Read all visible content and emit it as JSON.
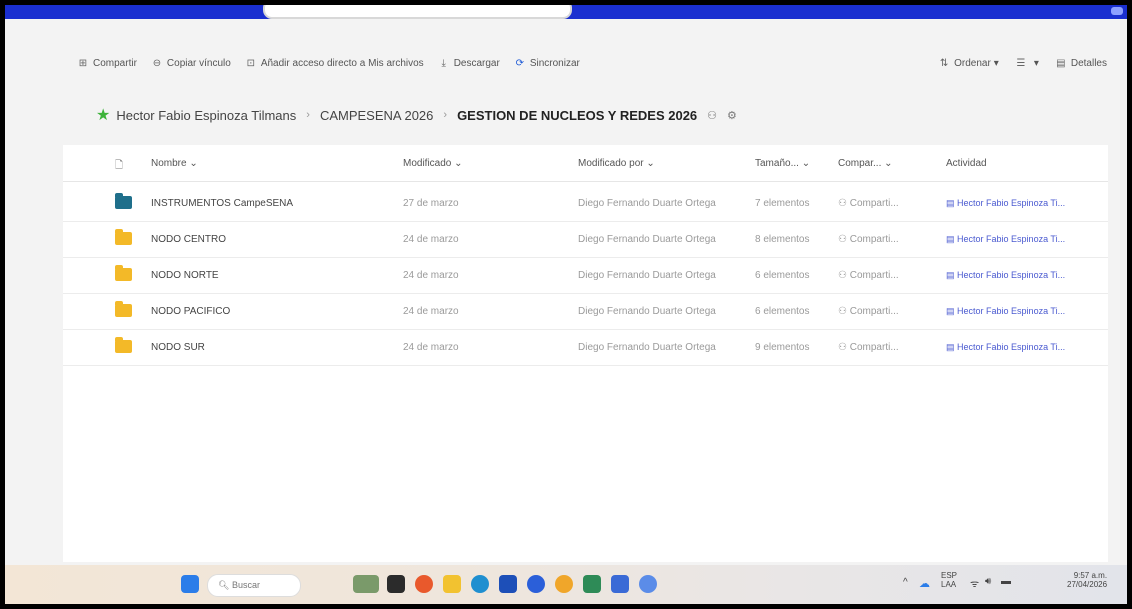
{
  "commands": {
    "left": [
      {
        "label": "Compartir",
        "icon": "share-icon"
      },
      {
        "label": "Copiar vínculo",
        "icon": "link-icon"
      },
      {
        "label": "Añadir acceso directo a Mis archivos",
        "icon": "shortcut-icon"
      },
      {
        "label": "Descargar",
        "icon": "download-icon"
      },
      {
        "label": "Sincronizar",
        "icon": "sync-icon"
      }
    ],
    "right": [
      {
        "label": "Ordenar",
        "icon": "sort-icon"
      },
      {
        "label": "",
        "icon": "view-options-icon"
      },
      {
        "label": "Detalles",
        "icon": "details-icon"
      }
    ]
  },
  "breadcrumb": {
    "items": [
      "Hector Fabio Espinoza Tilmans",
      "CAMPESENA 2026"
    ],
    "current": "GESTION DE NUCLEOS Y REDES 2026"
  },
  "table": {
    "columns": [
      "Nombre",
      "Modificado",
      "Modificado por",
      "Tamaño...",
      "Compar...",
      "Actividad"
    ],
    "rows": [
      {
        "name": "INSTRUMENTOS CampeSENA",
        "modified": "27 de marzo",
        "modified_by": "Diego Fernando Duarte Ortega",
        "size": "7 elementos",
        "shared": "Comparti...",
        "activity": "Hector Fabio Espinoza Ti...",
        "folder_color": "teal"
      },
      {
        "name": "NODO CENTRO",
        "modified": "24 de marzo",
        "modified_by": "Diego Fernando Duarte Ortega",
        "size": "8 elementos",
        "shared": "Comparti...",
        "activity": "Hector Fabio Espinoza Ti...",
        "folder_color": "yellow"
      },
      {
        "name": "NODO NORTE",
        "modified": "24 de marzo",
        "modified_by": "Diego Fernando Duarte Ortega",
        "size": "6 elementos",
        "shared": "Comparti...",
        "activity": "Hector Fabio Espinoza Ti...",
        "folder_color": "yellow"
      },
      {
        "name": "NODO PACIFICO",
        "modified": "24 de marzo",
        "modified_by": "Diego Fernando Duarte Ortega",
        "size": "6 elementos",
        "shared": "Comparti...",
        "activity": "Hector Fabio Espinoza Ti...",
        "folder_color": "yellow"
      },
      {
        "name": "NODO SUR",
        "modified": "24 de marzo",
        "modified_by": "Diego Fernando Duarte Ortega",
        "size": "9 elementos",
        "shared": "Comparti...",
        "activity": "Hector Fabio Espinoza Ti...",
        "folder_color": "yellow"
      }
    ]
  },
  "taskbar": {
    "search_placeholder": "Buscar",
    "lang_top": "ESP",
    "lang_bottom": "LAA",
    "time": "9:57 a.m.",
    "date": "27/04/2026"
  },
  "colors": {
    "top_bar": "#1a2fd0",
    "folder_teal": "#1f6f8b",
    "folder_yellow": "#f3b928",
    "star_green": "#3db33a"
  }
}
